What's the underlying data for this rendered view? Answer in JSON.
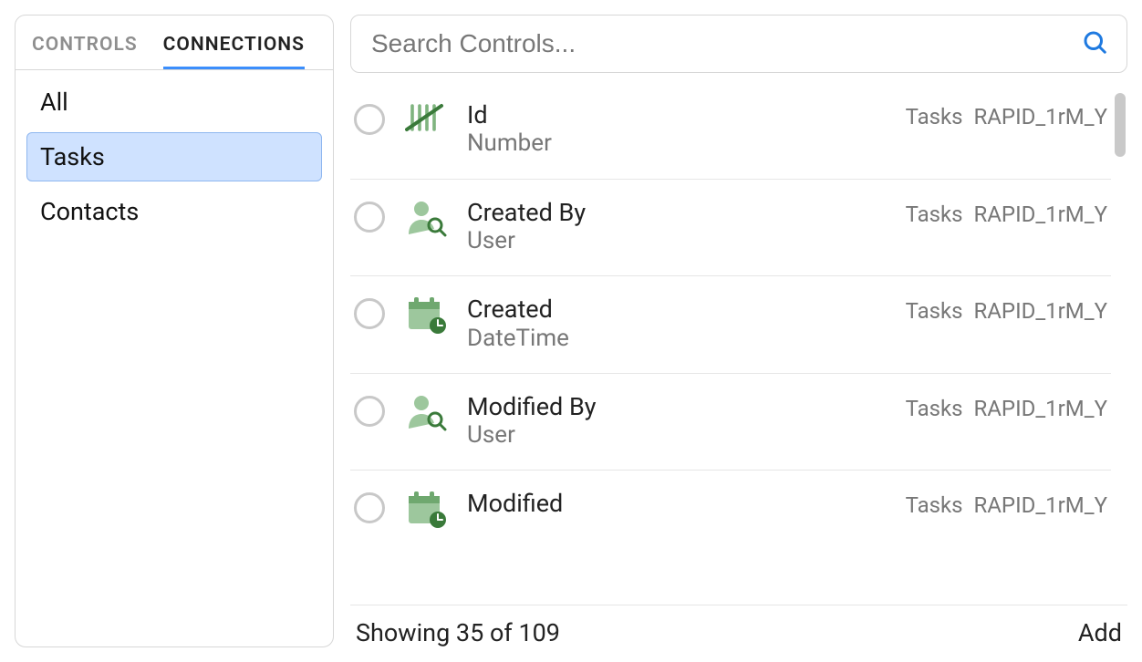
{
  "sidebar": {
    "tabs": [
      {
        "label": "CONTROLS",
        "active": false
      },
      {
        "label": "CONNECTIONS",
        "active": true
      }
    ],
    "items": [
      {
        "label": "All",
        "selected": false
      },
      {
        "label": "Tasks",
        "selected": true
      },
      {
        "label": "Contacts",
        "selected": false
      }
    ]
  },
  "search": {
    "placeholder": "Search Controls..."
  },
  "controls": [
    {
      "title": "Id",
      "type": "Number",
      "icon": "tally",
      "source1": "Tasks",
      "source2": "RAPID_1rM_Y"
    },
    {
      "title": "Created By",
      "type": "User",
      "icon": "user",
      "source1": "Tasks",
      "source2": "RAPID_1rM_Y"
    },
    {
      "title": "Created",
      "type": "DateTime",
      "icon": "datetime",
      "source1": "Tasks",
      "source2": "RAPID_1rM_Y"
    },
    {
      "title": "Modified By",
      "type": "User",
      "icon": "user",
      "source1": "Tasks",
      "source2": "RAPID_1rM_Y"
    },
    {
      "title": "Modified",
      "type": "DateTime",
      "icon": "datetime",
      "source1": "Tasks",
      "source2": "RAPID_1rM_Y"
    }
  ],
  "footer": {
    "showing": "Showing 35 of 109",
    "add": "Add"
  }
}
